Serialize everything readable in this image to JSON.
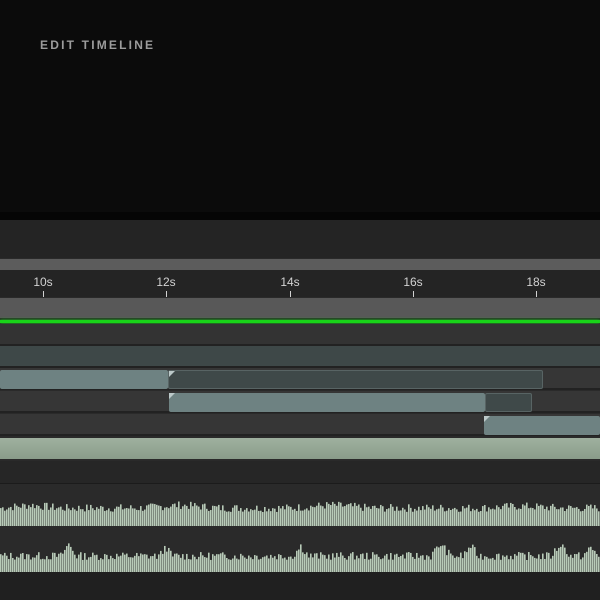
{
  "title": "EDIT TIMELINE",
  "ruler": {
    "ticks": [
      "10s",
      "12s",
      "14s",
      "16s",
      "18s"
    ]
  },
  "colors": {
    "playhead": "#19d319",
    "clip": "#6e8282",
    "audio_wave": "#b8cbb8"
  },
  "icons": {
    "clip_marker": "corner-triangle-icon"
  }
}
